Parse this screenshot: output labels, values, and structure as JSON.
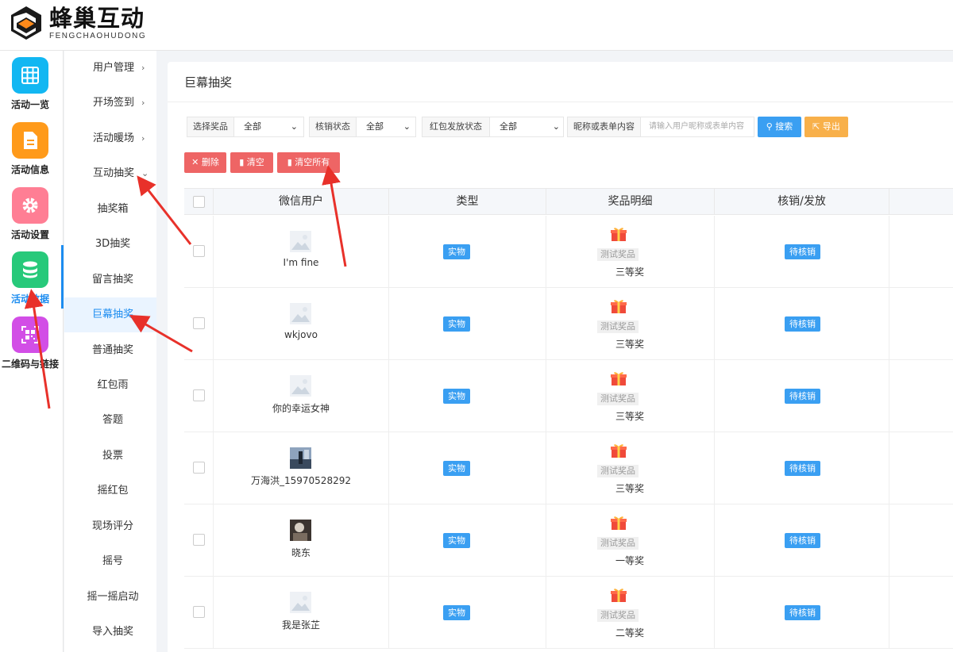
{
  "brand": {
    "name_cn": "蜂巢互动",
    "name_en": "FENGCHAOHUDONG"
  },
  "rail": [
    {
      "label": "活动一览",
      "icon": "grid-icon",
      "color": "#12b7f2"
    },
    {
      "label": "活动信息",
      "icon": "document-icon",
      "color": "#ff9a1a"
    },
    {
      "label": "活动设置",
      "icon": "gear-icon",
      "color": "#ff7e94"
    },
    {
      "label": "活动数据",
      "icon": "database-icon",
      "color": "#27c97a",
      "active": true
    },
    {
      "label": "二维码与链接",
      "icon": "qrcode-icon",
      "color": "#d24ee6"
    }
  ],
  "submenu": {
    "parents": [
      "用户管理",
      "开场签到",
      "活动暖场",
      "互动抽奖"
    ],
    "children": [
      "抽奖箱",
      "3D抽奖",
      "留言抽奖",
      "巨幕抽奖",
      "普通抽奖",
      "红包雨",
      "答题",
      "投票",
      "摇红包",
      "现场评分",
      "摇号",
      "摇一摇启动",
      "导入抽奖"
    ],
    "active": "巨幕抽奖"
  },
  "page": {
    "title": "巨幕抽奖"
  },
  "filters": {
    "prize_label": "选择奖品",
    "prize_value": "全部",
    "verify_label": "核销状态",
    "verify_value": "全部",
    "redpack_label": "红包发放状态",
    "redpack_value": "全部",
    "keyword_label": "昵称或表单内容",
    "keyword_placeholder": "请输入用户昵称或表单内容",
    "search_btn": "搜索",
    "export_btn": "导出"
  },
  "actions": {
    "delete": "删除",
    "clear": "清空",
    "clear_all": "清空所有"
  },
  "table": {
    "columns": [
      "微信用户",
      "类型",
      "奖品明细",
      "核销/发放"
    ],
    "rows": [
      {
        "user": "I'm fine",
        "avatar": "placeholder",
        "type": "实物",
        "prize": "测试奖品",
        "level": "三等奖",
        "status": "待核销"
      },
      {
        "user": "wkjovo",
        "avatar": "placeholder",
        "type": "实物",
        "prize": "测试奖品",
        "level": "三等奖",
        "status": "待核销"
      },
      {
        "user": "你的幸运女神",
        "avatar": "placeholder",
        "type": "实物",
        "prize": "测试奖品",
        "level": "三等奖",
        "status": "待核销"
      },
      {
        "user": "万海洪_15970528292",
        "avatar": "photo",
        "type": "实物",
        "prize": "测试奖品",
        "level": "三等奖",
        "status": "待核销"
      },
      {
        "user": "晓东",
        "avatar": "photo-dark",
        "type": "实物",
        "prize": "测试奖品",
        "level": "一等奖",
        "status": "待核销"
      },
      {
        "user": "我是张芷",
        "avatar": "placeholder",
        "type": "实物",
        "prize": "测试奖品",
        "level": "二等奖",
        "status": "待核销"
      }
    ]
  },
  "colors": {
    "accent": "#1c8cf0",
    "danger": "#ee6565",
    "export": "#f8b04a",
    "annotation": "#e8312a"
  }
}
